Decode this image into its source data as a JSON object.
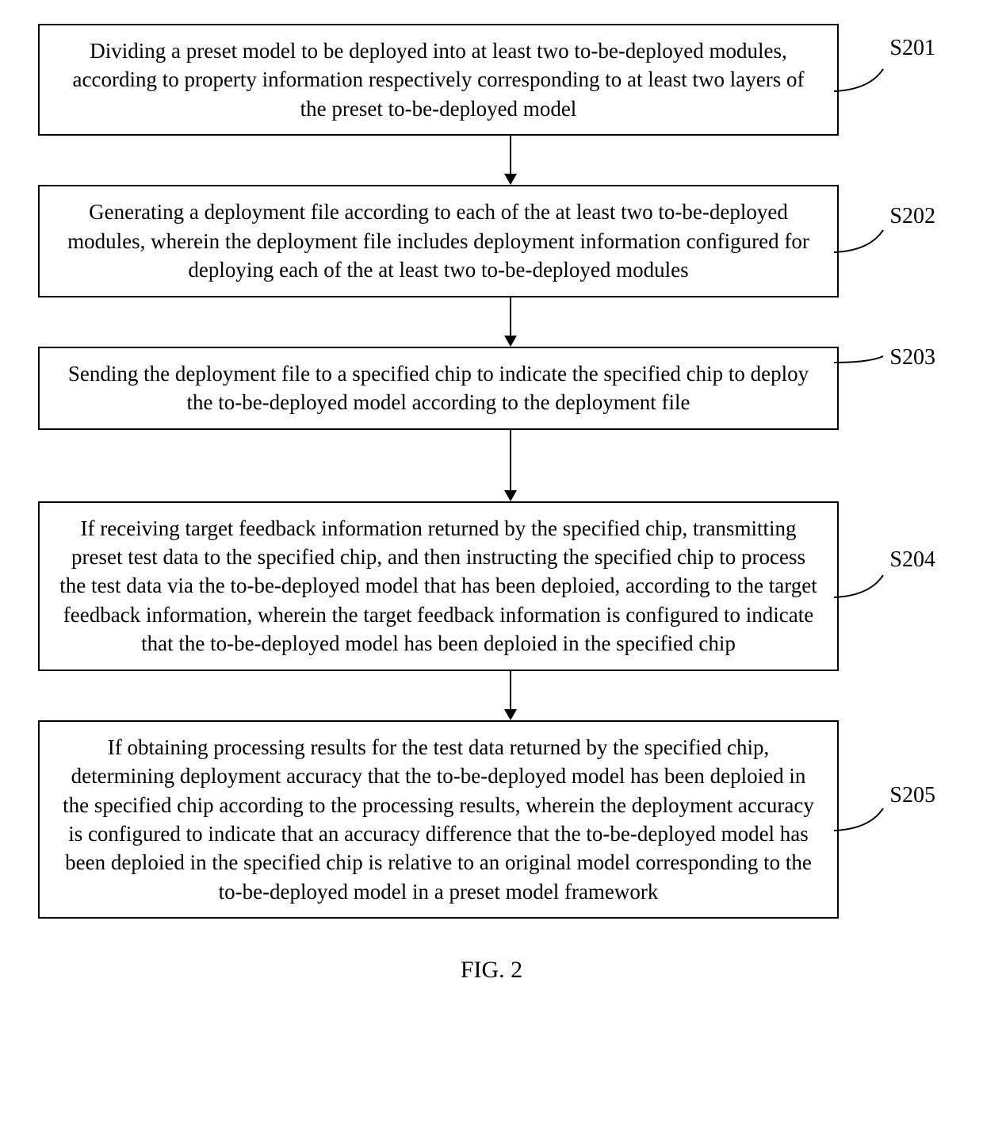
{
  "chart_data": {
    "type": "flowchart",
    "caption": "FIG. 2",
    "steps": [
      {
        "id": "S201",
        "text": "Dividing a preset model to be deployed into at least two to-be-deployed modules, according to property information respectively corresponding to at least two layers of the preset to-be-deployed model"
      },
      {
        "id": "S202",
        "text": "Generating a deployment file according to each of the at least two to-be-deployed modules, wherein the deployment file includes deployment information configured for deploying each of the at least two to-be-deployed modules"
      },
      {
        "id": "S203",
        "text": "Sending the deployment file to a specified chip to indicate the specified chip to deploy the to-be-deployed model according to the deployment file"
      },
      {
        "id": "S204",
        "text": "If receiving target feedback information returned by the specified chip, transmitting preset test data to the specified chip, and then instructing the specified chip to process the test data via the to-be-deployed model that has been deploied, according to the target feedback information, wherein the target feedback information is configured to indicate that the to-be-deployed model has been deploied in the specified chip"
      },
      {
        "id": "S205",
        "text": "If obtaining processing results for the test data returned by the specified chip, determining deployment accuracy that the to-be-deployed model has been deploied in the specified chip according to the processing results, wherein the deployment accuracy is configured to indicate that an accuracy difference that the to-be-deployed model has been deploied in the specified chip is relative to an original model corresponding to the to-be-deployed model in a preset model framework"
      }
    ]
  }
}
